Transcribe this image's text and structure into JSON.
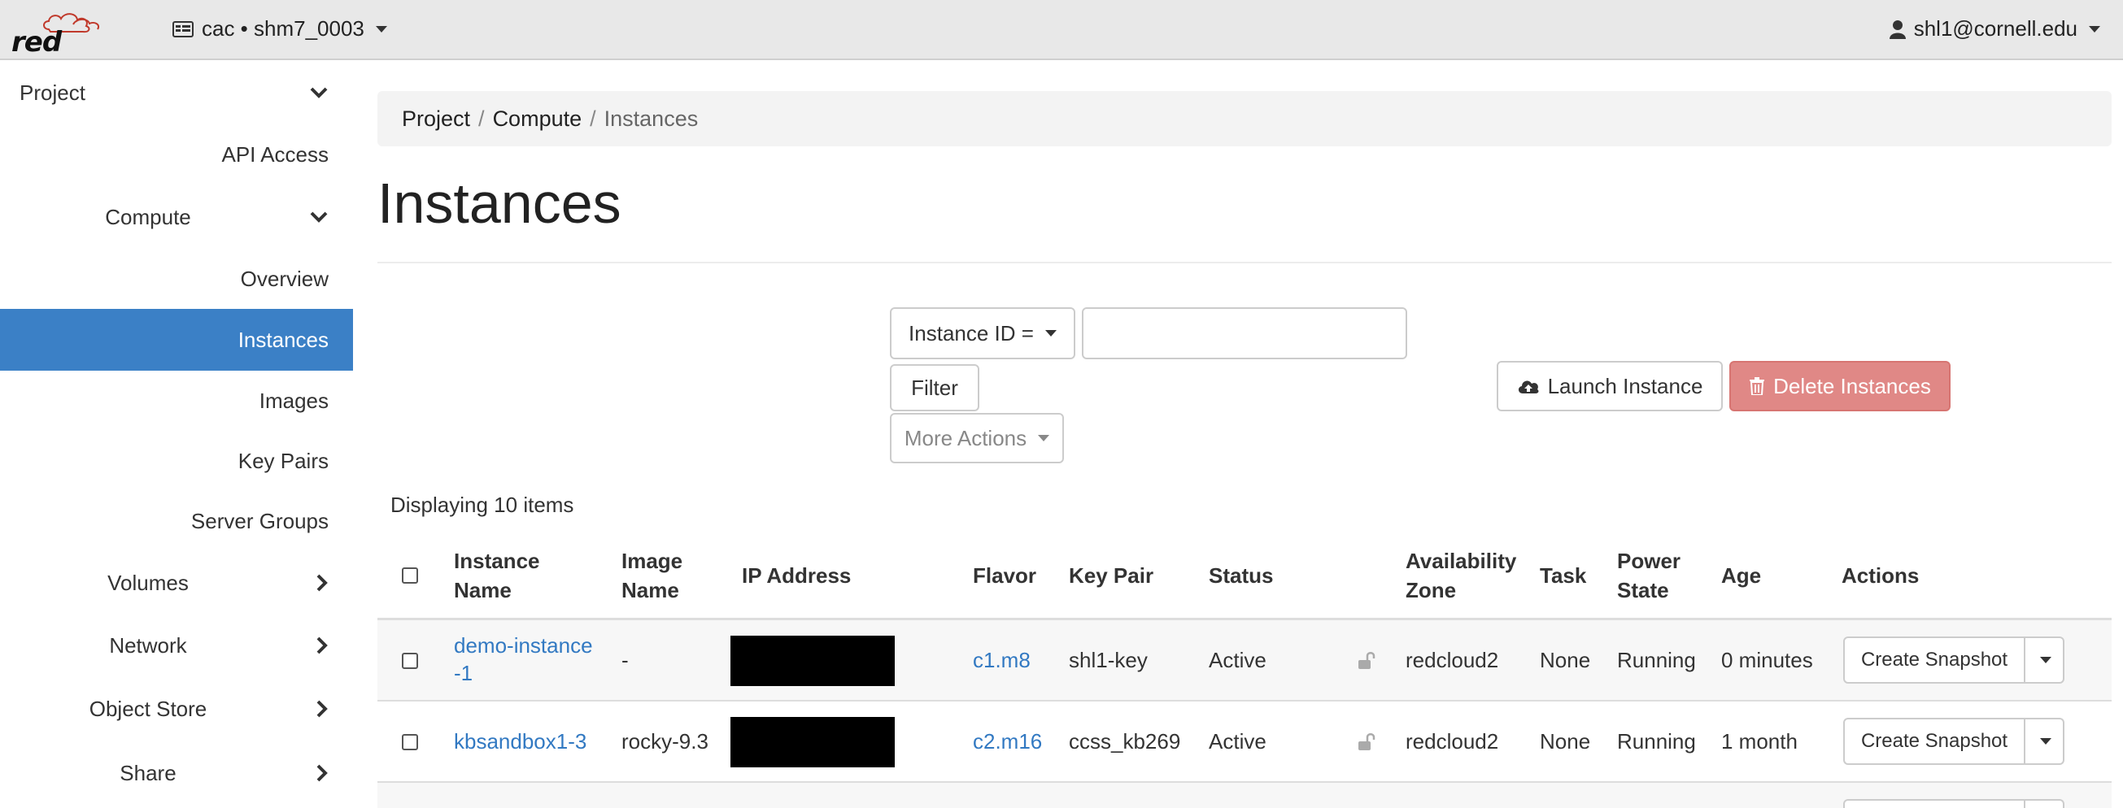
{
  "brand": {
    "logo_text": "red cloud"
  },
  "header": {
    "project_switch": "cac • shm7_0003",
    "user": "shl1@cornell.edu"
  },
  "sidebar": {
    "project": "Project",
    "api_access": "API Access",
    "compute": "Compute",
    "compute_items": [
      "Overview",
      "Instances",
      "Images",
      "Key Pairs",
      "Server Groups"
    ],
    "volumes": "Volumes",
    "network": "Network",
    "object_store": "Object Store",
    "share": "Share"
  },
  "breadcrumb": [
    "Project",
    "Compute",
    "Instances"
  ],
  "page": {
    "title": "Instances"
  },
  "filter": {
    "field_select": "Instance ID =",
    "input_value": "",
    "filter_button": "Filter",
    "more_actions": "More Actions"
  },
  "actions": {
    "launch": "Launch Instance",
    "delete": "Delete Instances"
  },
  "table": {
    "count_label": "Displaying 10 items",
    "headers": {
      "instance_name": [
        "Instance",
        "Name"
      ],
      "image_name": [
        "Image",
        "Name"
      ],
      "ip_address": "IP Address",
      "flavor": "Flavor",
      "key_pair": "Key Pair",
      "status": "Status",
      "availability_zone": [
        "Availability",
        "Zone"
      ],
      "task": "Task",
      "power_state": [
        "Power",
        "State"
      ],
      "age": "Age",
      "actions": "Actions"
    },
    "rows": [
      {
        "name_line1": "demo-instance",
        "name_line2": "-1",
        "image": "-",
        "flavor": "c1.m8",
        "key_pair": "shl1-key",
        "status": "Active",
        "zone": "redcloud2",
        "task": "None",
        "power": "Running",
        "age": "0 minutes",
        "action": "Create Snapshot"
      },
      {
        "name_line1": "kbsandbox1-3",
        "name_line2": "",
        "image": "rocky-9.3",
        "flavor": "c2.m16",
        "key_pair": "ccss_kb269",
        "status": "Active",
        "zone": "redcloud2",
        "task": "None",
        "power": "Running",
        "age": "1 month",
        "action": "Create Snapshot"
      }
    ]
  },
  "colors": {
    "accent": "#3b80c6",
    "danger": "#e08886",
    "link": "#3279c2"
  },
  "icons": {
    "project_switch": "id-card-icon",
    "user": "user-icon",
    "launch": "cloud-upload-icon",
    "delete": "trash-icon",
    "lock": "unlock-icon"
  }
}
